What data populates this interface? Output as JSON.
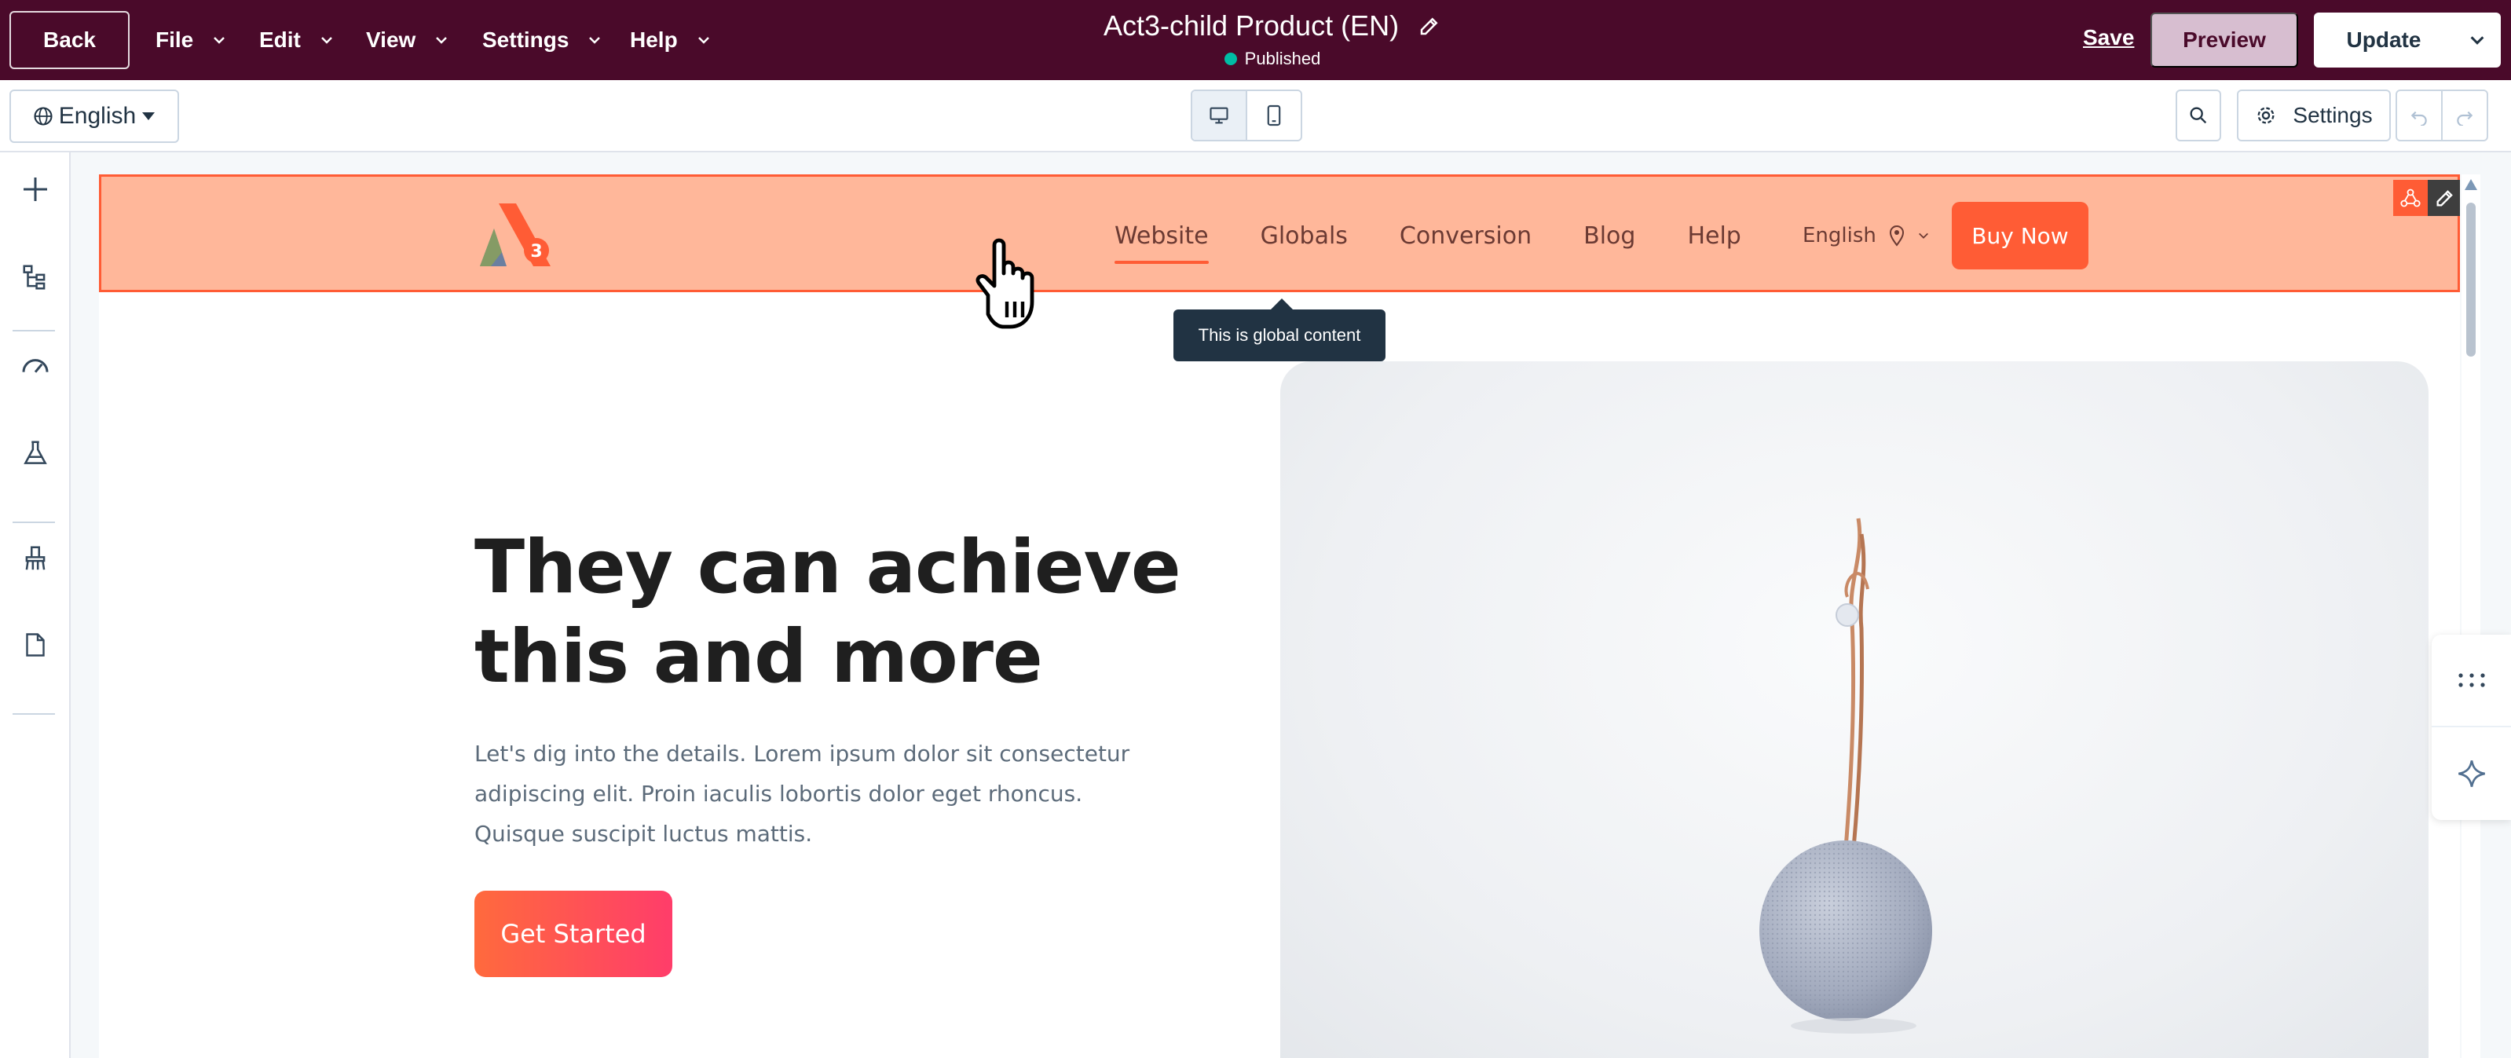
{
  "topbar": {
    "back_label": "Back",
    "menus": [
      {
        "label": "File"
      },
      {
        "label": "Edit"
      },
      {
        "label": "View"
      },
      {
        "label": "Settings"
      },
      {
        "label": "Help"
      }
    ],
    "page_title": "Act3-child Product (EN)",
    "status": "Published",
    "save_label": "Save",
    "preview_label": "Preview",
    "update_label": "Update",
    "bg_color": "#4a0a2a"
  },
  "toolbar": {
    "language": "English",
    "settings_label": "Settings",
    "device_modes": [
      "desktop-icon",
      "mobile-icon"
    ]
  },
  "left_rail": {
    "icons": [
      "add-icon",
      "tree-icon",
      "speedometer-icon",
      "flask-icon",
      "brush-icon",
      "page-icon"
    ]
  },
  "site_header": {
    "nav": [
      {
        "label": "Website",
        "active": true
      },
      {
        "label": "Globals"
      },
      {
        "label": "Conversion"
      },
      {
        "label": "Blog"
      },
      {
        "label": "Help"
      }
    ],
    "language": "English",
    "buy_label": "Buy Now",
    "highlight_color": "#ff5c35",
    "tooltip": "This is global content"
  },
  "hero": {
    "title_line1": "They can achieve",
    "title_line2": "this and more",
    "body_line1": "Let's dig into the details. Lorem ipsum dolor sit consectetur",
    "body_line2": "adipiscing elit. Proin iaculis lobortis dolor eget rhoncus.",
    "body_line3": "Quisque suscipit luctus mattis.",
    "cta_label": "Get Started"
  }
}
